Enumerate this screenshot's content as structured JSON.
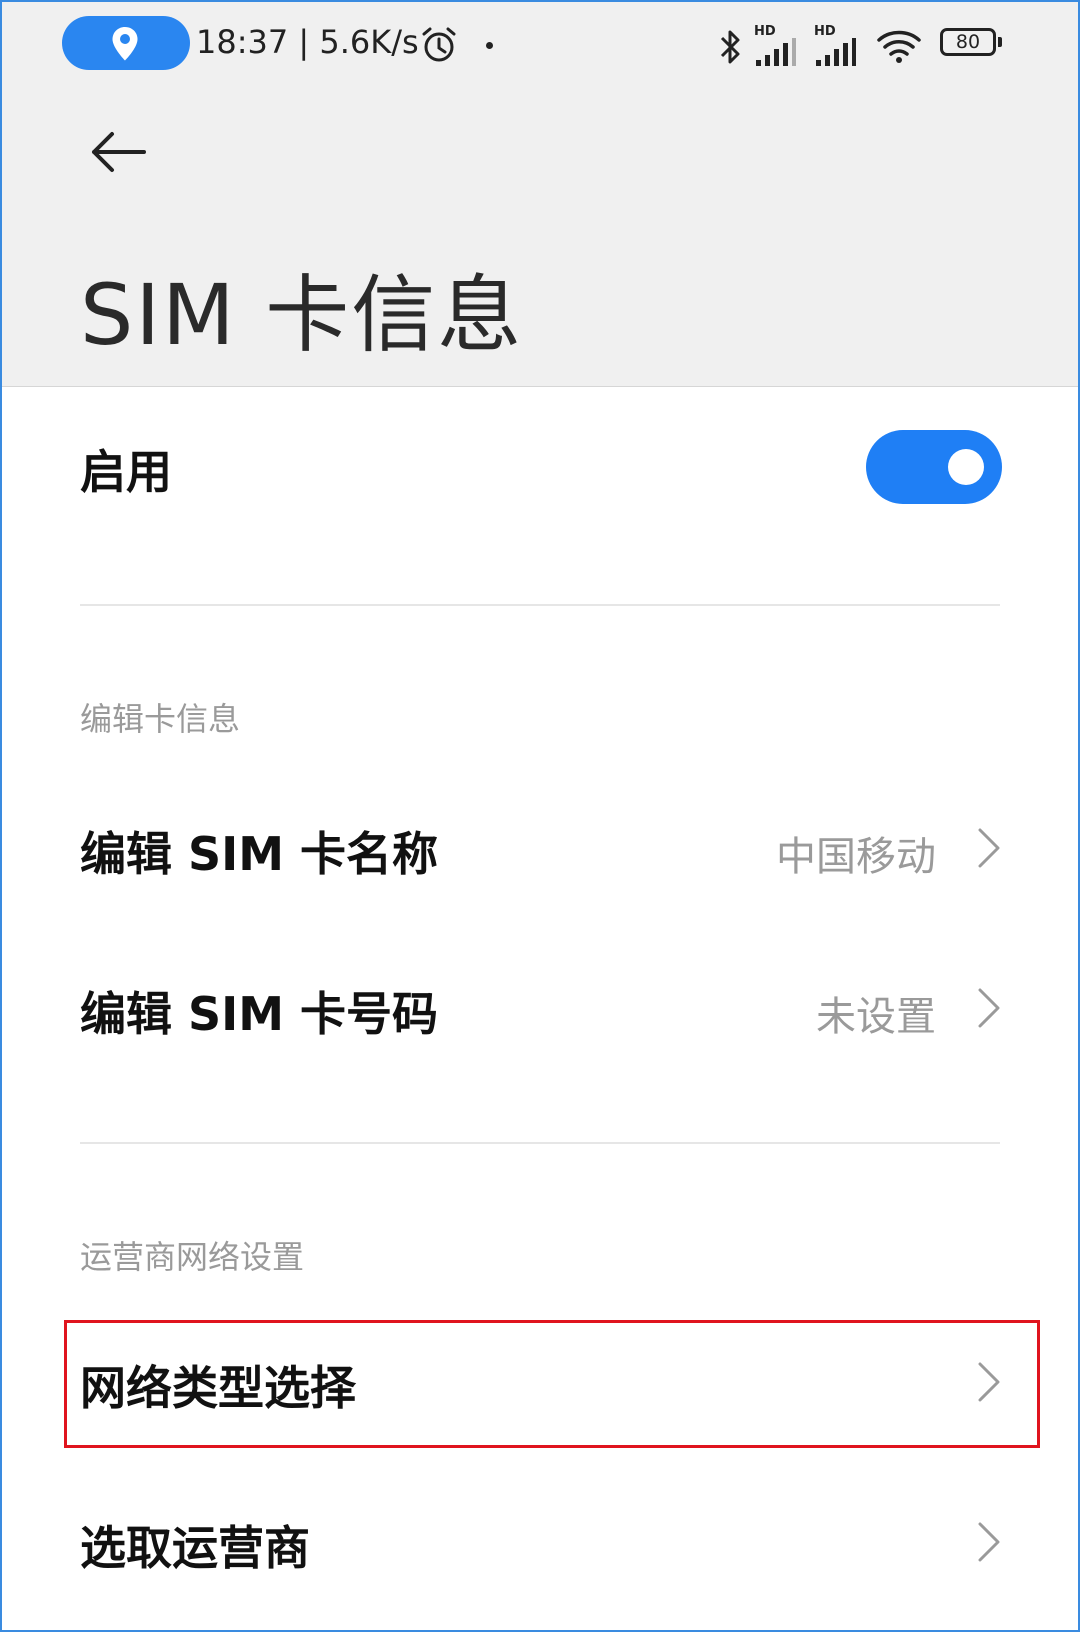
{
  "status_bar": {
    "time_speed": "18:37 | 5.6K/s",
    "battery": "80",
    "signal_badge_1": "HD",
    "signal_badge_2": "HD",
    "icons": [
      "location-icon",
      "alarm-icon",
      "bluetooth-icon",
      "signal-icon",
      "wifi-icon",
      "battery-icon"
    ]
  },
  "header": {
    "title": "SIM 卡信息"
  },
  "enable": {
    "label": "启用",
    "state": "on"
  },
  "edit_section": {
    "label": "编辑卡信息",
    "items": [
      {
        "label": "编辑 SIM 卡名称",
        "value": "中国移动"
      },
      {
        "label": "编辑 SIM 卡号码",
        "value": "未设置"
      }
    ]
  },
  "carrier_section": {
    "label": "运营商网络设置",
    "items": [
      {
        "label": "网络类型选择"
      },
      {
        "label": "选取运营商"
      }
    ]
  },
  "colors": {
    "accent": "#1f7ff5",
    "highlight": "#e0141e"
  }
}
